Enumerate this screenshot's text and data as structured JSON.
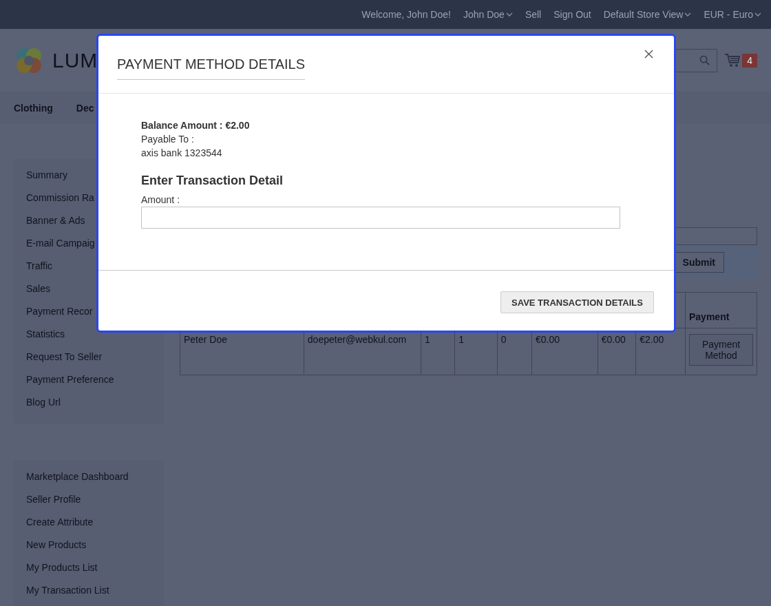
{
  "top_links": [
    {
      "label": "Welcome, John Doe!",
      "kind": "text"
    },
    {
      "label": "John Doe",
      "kind": "dropdown"
    },
    {
      "label": "Sell",
      "kind": "link"
    },
    {
      "label": "Sign Out",
      "kind": "link"
    },
    {
      "label": "Default Store View",
      "kind": "dropdown"
    },
    {
      "label": "EUR - Euro",
      "kind": "dropdown"
    }
  ],
  "logo": {
    "text": "LUM"
  },
  "cart": {
    "count": "4"
  },
  "nav": [
    {
      "label": "Clothing"
    },
    {
      "label": "Dec"
    }
  ],
  "sidebar_groups": [
    {
      "items": [
        "Summary",
        "Commission Ra",
        "Banner & Ads",
        "E-mail Campaig",
        "Traffic",
        "Sales",
        "Payment Recor",
        "Statistics",
        "Request To Seller",
        "Payment Preference",
        "Blog Url"
      ]
    },
    {
      "items": [
        "Marketplace Dashboard",
        "Seller Profile",
        "Create Attribute",
        "New Products",
        "My Products List",
        "My Transaction List"
      ]
    }
  ],
  "filter": {
    "button": "Submit"
  },
  "table": {
    "payment_heading": "Payment",
    "rows": [
      {
        "cells": [
          "Peter Doe",
          "doepeter@webkul.com",
          "1",
          "1",
          "0",
          "€0.00",
          "€0.00",
          "€2.00"
        ],
        "action": "Payment Method"
      }
    ]
  },
  "modal": {
    "title": "PAYMENT METHOD DETAILS",
    "balance": "Balance Amount : €2.00",
    "payable_label": "Payable To :",
    "payable_value": "axis bank 1323544",
    "section_title": "Enter Transaction Detail",
    "amount_label": "Amount :",
    "save_button": "SAVE TRANSACTION DETAILS"
  }
}
